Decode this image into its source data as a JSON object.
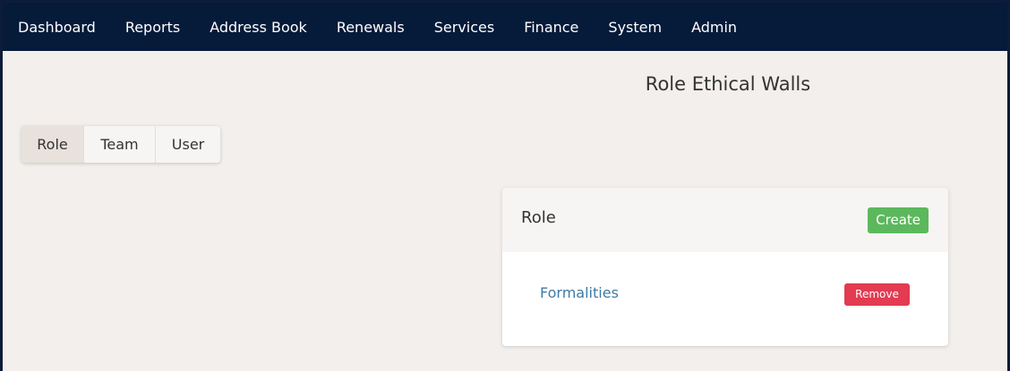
{
  "nav": {
    "items": [
      {
        "label": "Dashboard"
      },
      {
        "label": "Reports"
      },
      {
        "label": "Address Book"
      },
      {
        "label": "Renewals"
      },
      {
        "label": "Services"
      },
      {
        "label": "Finance"
      },
      {
        "label": "System"
      },
      {
        "label": "Admin"
      }
    ]
  },
  "page": {
    "title": "Role Ethical Walls"
  },
  "tabs": [
    {
      "label": "Role",
      "active": true
    },
    {
      "label": "Team",
      "active": false
    },
    {
      "label": "User",
      "active": false
    }
  ],
  "panel": {
    "title": "Role",
    "create_label": "Create",
    "rows": [
      {
        "name": "Formalities",
        "remove_label": "Remove"
      }
    ]
  },
  "colors": {
    "nav_bg": "#061a3a",
    "page_bg": "#f2efec",
    "create_button": "#5cb85c",
    "remove_button": "#e23b52",
    "link": "#3f7aa5"
  }
}
